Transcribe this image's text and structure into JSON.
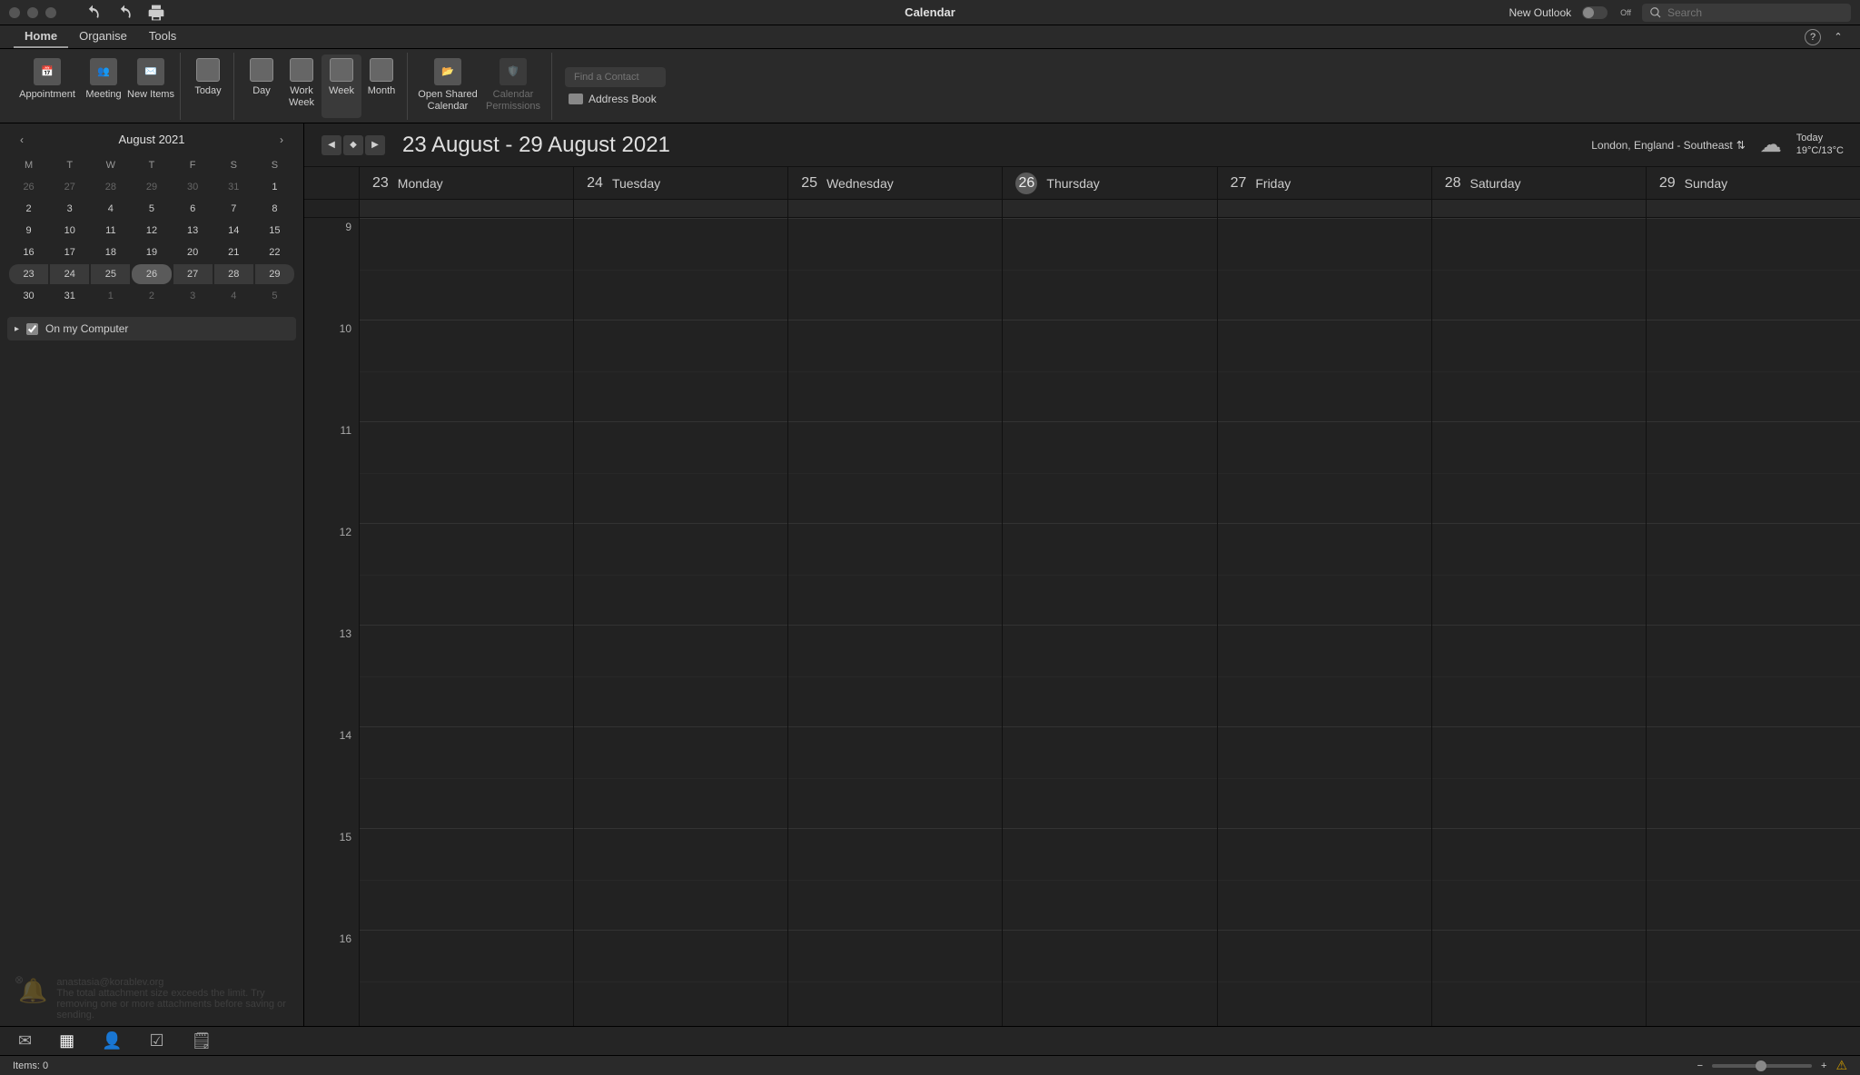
{
  "titlebar": {
    "title": "Calendar",
    "new_outlook_label": "New Outlook",
    "new_outlook_toggle_state": "Off",
    "search_placeholder": "Search"
  },
  "menubar": {
    "tabs": [
      "Home",
      "Organise",
      "Tools"
    ],
    "active_index": 0
  },
  "ribbon": {
    "appointment": "Appointment",
    "meeting": "Meeting",
    "new_items": "New Items",
    "today": "Today",
    "day": "Day",
    "work_week": "Work Week",
    "week": "Week",
    "month": "Month",
    "open_shared": "Open Shared Calendar",
    "permissions": "Calendar Permissions",
    "find_contact_placeholder": "Find a Contact",
    "address_book": "Address Book"
  },
  "sidebar": {
    "mini_month": "August 2021",
    "dow": [
      "M",
      "T",
      "W",
      "T",
      "F",
      "S",
      "S"
    ],
    "weeks": [
      {
        "days": [
          "26",
          "27",
          "28",
          "29",
          "30",
          "31",
          "1"
        ],
        "dim_start": 5
      },
      {
        "days": [
          "2",
          "3",
          "4",
          "5",
          "6",
          "7",
          "8"
        ]
      },
      {
        "days": [
          "9",
          "10",
          "11",
          "12",
          "13",
          "14",
          "15"
        ]
      },
      {
        "days": [
          "16",
          "17",
          "18",
          "19",
          "20",
          "21",
          "22"
        ]
      },
      {
        "days": [
          "23",
          "24",
          "25",
          "26",
          "27",
          "28",
          "29"
        ],
        "selected": true,
        "today_idx": 3
      },
      {
        "days": [
          "30",
          "31",
          "1",
          "2",
          "3",
          "4",
          "5"
        ],
        "dim_from": 2
      }
    ],
    "on_my_computer": "On my Computer"
  },
  "calendar": {
    "range_title": "23 August - 29 August 2021",
    "location": "London, England - Southeast",
    "weather_today_label": "Today",
    "weather_temps": "19°C/13°C",
    "days": [
      {
        "num": "23",
        "name": "Monday"
      },
      {
        "num": "24",
        "name": "Tuesday"
      },
      {
        "num": "25",
        "name": "Wednesday"
      },
      {
        "num": "26",
        "name": "Thursday",
        "today": true
      },
      {
        "num": "27",
        "name": "Friday"
      },
      {
        "num": "28",
        "name": "Saturday"
      },
      {
        "num": "29",
        "name": "Sunday"
      }
    ],
    "hours": [
      "9",
      "10",
      "11",
      "12",
      "13",
      "14",
      "15",
      "16"
    ]
  },
  "notification": {
    "from": "anastasia@korablev.org",
    "text": "The total attachment size exceeds the limit. Try removing one or more attachments before saving or sending."
  },
  "statusbar": {
    "items": "Items: 0"
  }
}
